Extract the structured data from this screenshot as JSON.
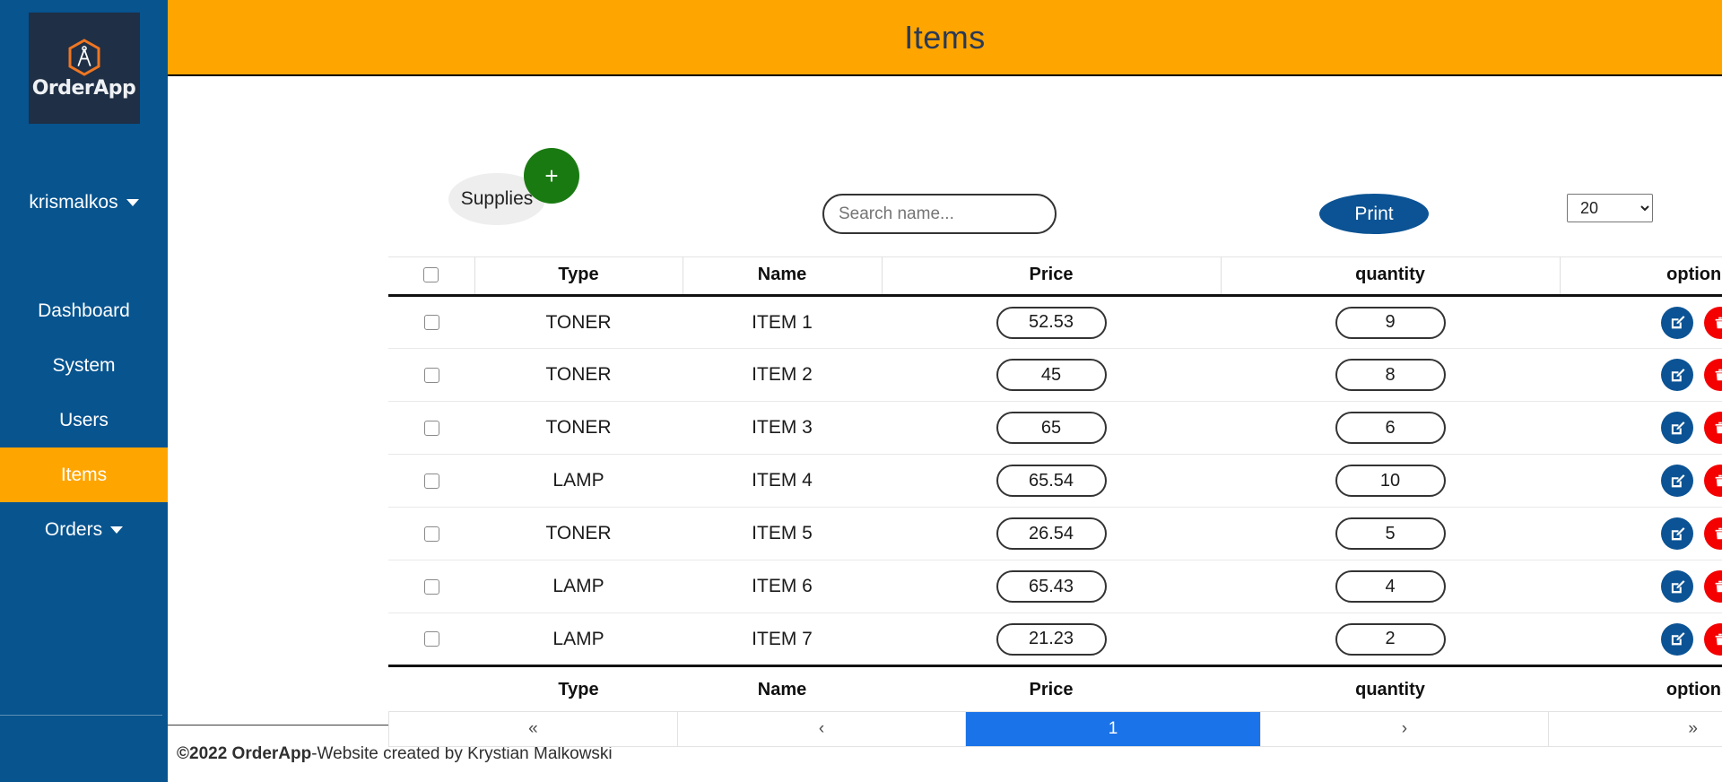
{
  "brand": {
    "logo_text": "OrderApp",
    "logo_icon": "compass-hexagon-icon"
  },
  "sidebar": {
    "user": "krismalkos",
    "items": [
      {
        "label": "Dashboard",
        "active": false,
        "caret": false
      },
      {
        "label": "System",
        "active": false,
        "caret": false
      },
      {
        "label": "Users",
        "active": false,
        "caret": false
      },
      {
        "label": "Items",
        "active": true,
        "caret": false
      },
      {
        "label": "Orders",
        "active": false,
        "caret": true
      }
    ]
  },
  "header": {
    "title": "Items"
  },
  "toolbar": {
    "supplies_label": "Supplies",
    "add_label": "+",
    "search_placeholder": "Search name...",
    "search_value": "",
    "print_label": "Print",
    "entries_selected": "20",
    "entries_options": [
      "20"
    ]
  },
  "table": {
    "columns": [
      "",
      "Type",
      "Name",
      "Price",
      "quantity",
      "options"
    ],
    "footer_columns": [
      "Type",
      "Name",
      "Price",
      "quantity",
      "options"
    ],
    "edit_icon": "edit-pencil-icon",
    "delete_icon": "trash-icon",
    "rows": [
      {
        "type": "TONER",
        "name": "ITEM 1",
        "price": "52.53",
        "quantity": "9"
      },
      {
        "type": "TONER",
        "name": "ITEM 2",
        "price": "45",
        "quantity": "8"
      },
      {
        "type": "TONER",
        "name": "ITEM 3",
        "price": "65",
        "quantity": "6"
      },
      {
        "type": "LAMP",
        "name": "ITEM 4",
        "price": "65.54",
        "quantity": "10"
      },
      {
        "type": "TONER",
        "name": "ITEM 5",
        "price": "26.54",
        "quantity": "5"
      },
      {
        "type": "LAMP",
        "name": "ITEM 6",
        "price": "65.43",
        "quantity": "4"
      },
      {
        "type": "LAMP",
        "name": "ITEM 7",
        "price": "21.23",
        "quantity": "2"
      }
    ]
  },
  "pagination": {
    "first": "«",
    "prev": "‹",
    "current": "1",
    "next": "›",
    "last": "»"
  },
  "footer": {
    "copyright": "©2022 OrderApp",
    "separator": " - ",
    "credit": "Website created by Krystian Malkowski"
  },
  "colors": {
    "sidebar_blue": "#07548f",
    "accent_orange": "#ffa500",
    "logo_navy": "#1f2f45",
    "primary_blue": "#0b5394",
    "danger_red": "#f40000",
    "success_green": "#1a7a12",
    "active_page_blue": "#1a73e8"
  }
}
